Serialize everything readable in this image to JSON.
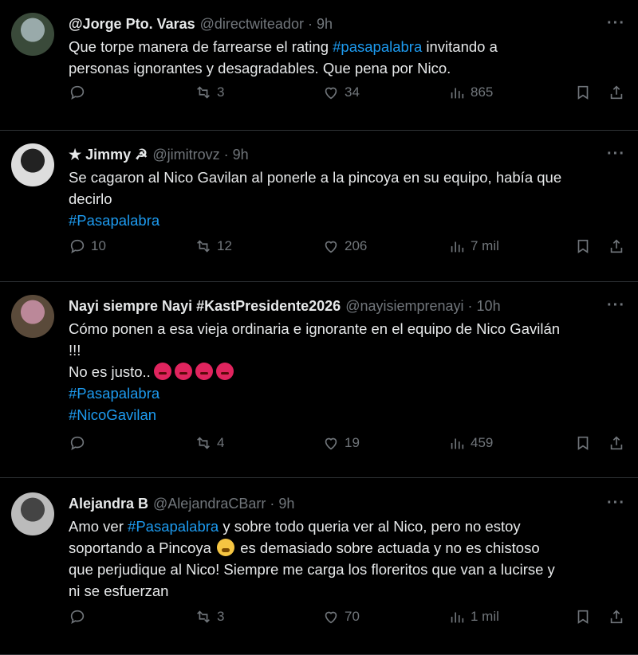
{
  "tweets": [
    {
      "name": "@Jorge Pto. Varas",
      "handle": "@directwiteador",
      "time": "9h",
      "lines": [
        [
          {
            "t": "Que torpe manera de farrearse el rating "
          },
          {
            "t": "#pasapalabra",
            "tag": true
          },
          {
            "t": " invitando a"
          }
        ],
        [
          {
            "t": "personas ignorantes y desagradables. Que pena por Nico."
          }
        ]
      ],
      "replies": "",
      "retweets": "3",
      "likes": "34",
      "views": "865"
    },
    {
      "name": "★ Jimmy ☭",
      "handle": "@jimitrovz",
      "time": "9h",
      "lines": [
        [
          {
            "t": "Se cagaron al Nico Gavilan al ponerle a la pincoya en su equipo, había que"
          }
        ],
        [
          {
            "t": "decirlo"
          }
        ],
        [
          {
            "t": "#Pasapalabra",
            "tag": true
          }
        ]
      ],
      "replies": "10",
      "retweets": "12",
      "likes": "206",
      "views": "7 mil"
    },
    {
      "name": "Nayi siempre Nayi #KastPresidente2026",
      "handle": "@nayisiemprenayi",
      "time": "10h",
      "lines": [
        [
          {
            "t": "Cómo ponen a esa vieja ordinaria e ignorante en el equipo de Nico Gavilán"
          }
        ],
        [
          {
            "t": "!!!"
          }
        ],
        [
          {
            "t": "No es justo.."
          },
          {
            "emoji": "angry",
            "count": 4
          }
        ],
        [
          {
            "t": "#Pasapalabra",
            "tag": true
          }
        ],
        [
          {
            "t": "#NicoGavilan",
            "tag": true
          }
        ]
      ],
      "replies": "",
      "retweets": "4",
      "likes": "19",
      "views": "459"
    },
    {
      "name": "Alejandra B",
      "handle": "@AlejandraCBarr",
      "time": "9h",
      "lines": [
        [
          {
            "t": "Amo ver "
          },
          {
            "t": "#Pasapalabra",
            "tag": true
          },
          {
            "t": " y sobre todo queria ver al Nico, pero no estoy"
          }
        ],
        [
          {
            "t": "soportando a Pincoya "
          },
          {
            "emoji": "tired",
            "count": 1
          },
          {
            "t": " es demasiado sobre actuada y no es chistoso"
          }
        ],
        [
          {
            "t": "que perjudique al Nico! Siempre me carga los floreritos que van a lucirse y"
          }
        ],
        [
          {
            "t": "ni se esfuerzan"
          }
        ]
      ],
      "replies": "",
      "retweets": "3",
      "likes": "70",
      "views": "1 mil"
    }
  ],
  "more_label": "···"
}
